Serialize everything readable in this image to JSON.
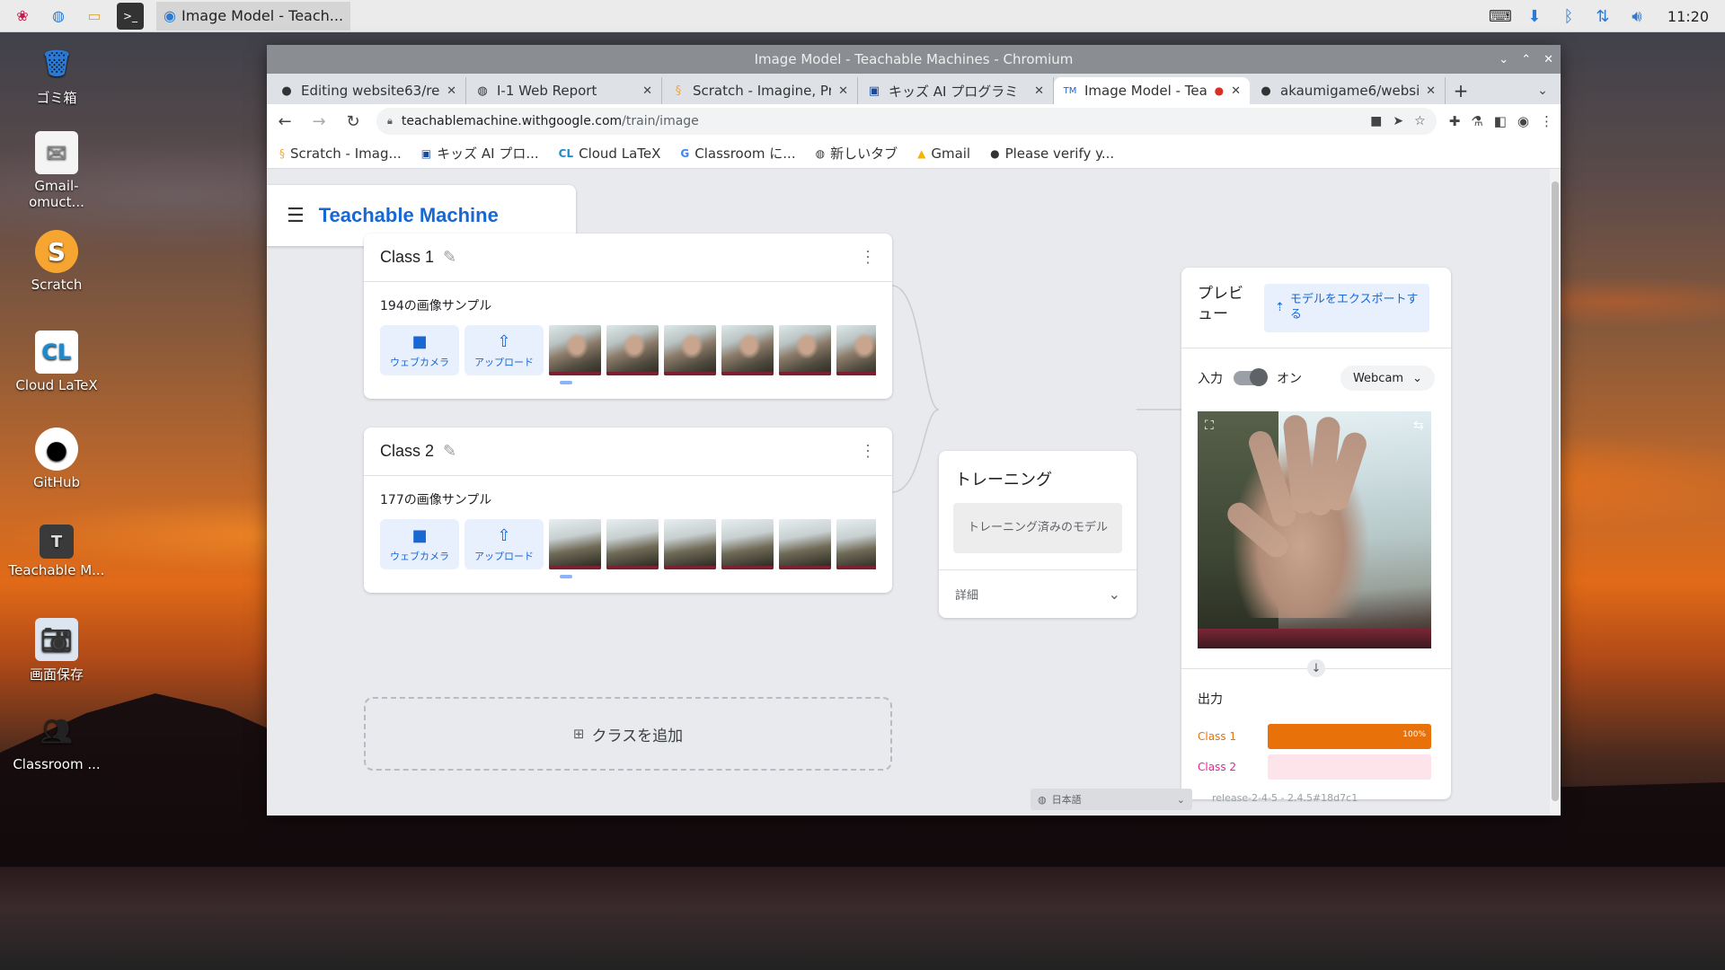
{
  "taskbar": {
    "active_task_label": "Image Model - Teach...",
    "clock": "11:20"
  },
  "desktop": {
    "icons": [
      {
        "label": "ゴミ箱",
        "icon": "trash-icon"
      },
      {
        "label": "Gmail-omuct...",
        "icon": "mail-icon"
      },
      {
        "label": "Scratch",
        "icon": "scratch-icon"
      },
      {
        "label": "Cloud LaTeX",
        "icon": "cloudlatex-icon"
      },
      {
        "label": "GitHub",
        "icon": "github-icon"
      },
      {
        "label": "Teachable M...",
        "icon": "teachable-icon"
      },
      {
        "label": "画面保存",
        "icon": "screenshot-icon"
      },
      {
        "label": "Classroom ...",
        "icon": "classroom-icon"
      }
    ]
  },
  "window": {
    "title": "Image Model - Teachable Machines - Chromium"
  },
  "tabs": [
    {
      "label": "Editing website63/rep",
      "icon": "github-icon",
      "active": false
    },
    {
      "label": "I-1 Web Report",
      "icon": "globe-icon",
      "active": false
    },
    {
      "label": "Scratch - Imagine, Pro",
      "icon": "scratch-icon",
      "active": false
    },
    {
      "label": "キッズ AI プログラミ",
      "icon": "kids-ai-icon",
      "active": false
    },
    {
      "label": "Image Model - Tea",
      "icon": "teachable-icon",
      "active": true
    },
    {
      "label": "akaumigame6/websi",
      "icon": "github-icon",
      "active": false
    }
  ],
  "omnibox": {
    "host": "teachablemachine.withgoogle.com",
    "path": "/train/image"
  },
  "bookmarks": [
    {
      "label": "Scratch - Imag...",
      "icon": "scratch-icon"
    },
    {
      "label": "キッズ AI プロ...",
      "icon": "kids-ai-icon"
    },
    {
      "label": "Cloud LaTeX",
      "icon": "cloudlatex-icon"
    },
    {
      "label": "Classroom に...",
      "icon": "google-icon"
    },
    {
      "label": "新しいタブ",
      "icon": "globe-icon"
    },
    {
      "label": "Gmail",
      "icon": "drive-icon"
    },
    {
      "label": "Please verify y...",
      "icon": "github-icon"
    }
  ],
  "app": {
    "brand": "Teachable Machine",
    "classes": [
      {
        "name": "Class 1",
        "samples": "194の画像サンプル",
        "webcam": "ウェブカメラ",
        "upload": "アップロード"
      },
      {
        "name": "Class 2",
        "samples": "177の画像サンプル",
        "webcam": "ウェブカメラ",
        "upload": "アップロード"
      }
    ],
    "add_class": "クラスを追加",
    "training": {
      "title": "トレーニング",
      "button": "トレーニング済みのモデル",
      "advanced": "詳細"
    },
    "preview": {
      "title": "プレビュー",
      "export": "モデルをエクスポートする",
      "input_label": "入力",
      "toggle_state": "オン",
      "source": "Webcam",
      "output_label": "出力",
      "outputs": [
        {
          "label": "Class 1",
          "value": 1.0,
          "pct_text": "100%",
          "color": "#e8710a",
          "track": "#fde0c4"
        },
        {
          "label": "Class 2",
          "value": 0.0,
          "pct_text": "",
          "color": "#e52592",
          "track": "#fde4ea"
        }
      ]
    },
    "footer": {
      "language": "日本語",
      "release": "release-2-4-5 - 2.4.5#18d7c1"
    }
  }
}
